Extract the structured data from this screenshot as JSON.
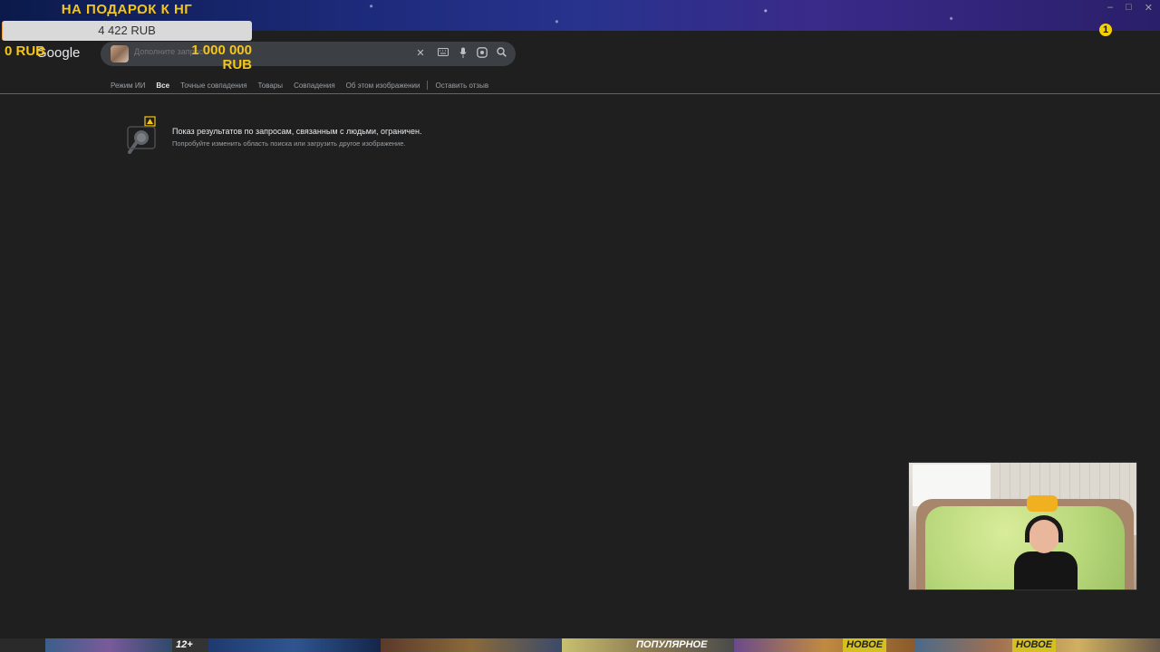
{
  "donation": {
    "title": "НА ПОДАРОК К НГ",
    "current": "4 422 RUB",
    "progress_fraction": 0.0044,
    "min": "0 RUB",
    "max": "1 000 000 RUB"
  },
  "window_controls": [
    "–",
    "□",
    "✕"
  ],
  "notification_count": "1",
  "google": {
    "logo": "Google",
    "search": {
      "placeholder": "Дополните запрос"
    },
    "tabs": [
      {
        "label": "Режим ИИ",
        "active": false
      },
      {
        "label": "Все",
        "active": true
      },
      {
        "label": "Точные совпадения",
        "active": false
      },
      {
        "label": "Товары",
        "active": false
      },
      {
        "label": "Совпадения",
        "active": false
      },
      {
        "label": "Об этом изображении",
        "active": false
      },
      {
        "label": "Оставить отзыв",
        "active": false
      }
    ],
    "notice": {
      "title": "Показ результатов по запросам, связанным с людьми, ограничен.",
      "subtitle": "Попробуйте изменить область поиска или загрузить другое изображение."
    }
  },
  "bottom_strip": {
    "labels": [
      "12+",
      "ПОПУЛЯРНОЕ",
      "НОВОЕ",
      "НОВОЕ"
    ]
  },
  "colors": {
    "page_bg": "#1f1f1f",
    "searchbox_bg": "#3c3f43",
    "donation_accent": "#f5c518",
    "donation_fill": "#f0a040"
  }
}
